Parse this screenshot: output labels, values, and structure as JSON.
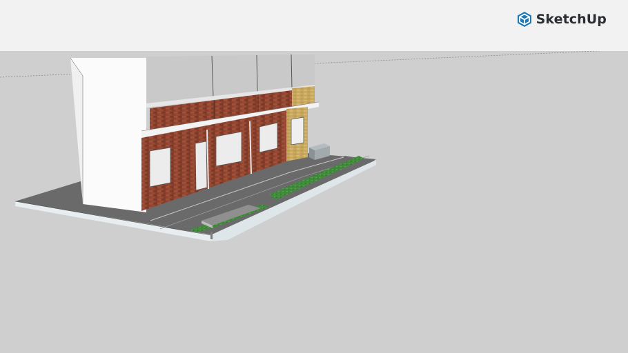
{
  "app": {
    "brand_name": "SketchUp",
    "brand_color": "#1c79b4"
  },
  "viewport": {
    "background": "#cfcfcf",
    "content": "3d-building-model"
  }
}
